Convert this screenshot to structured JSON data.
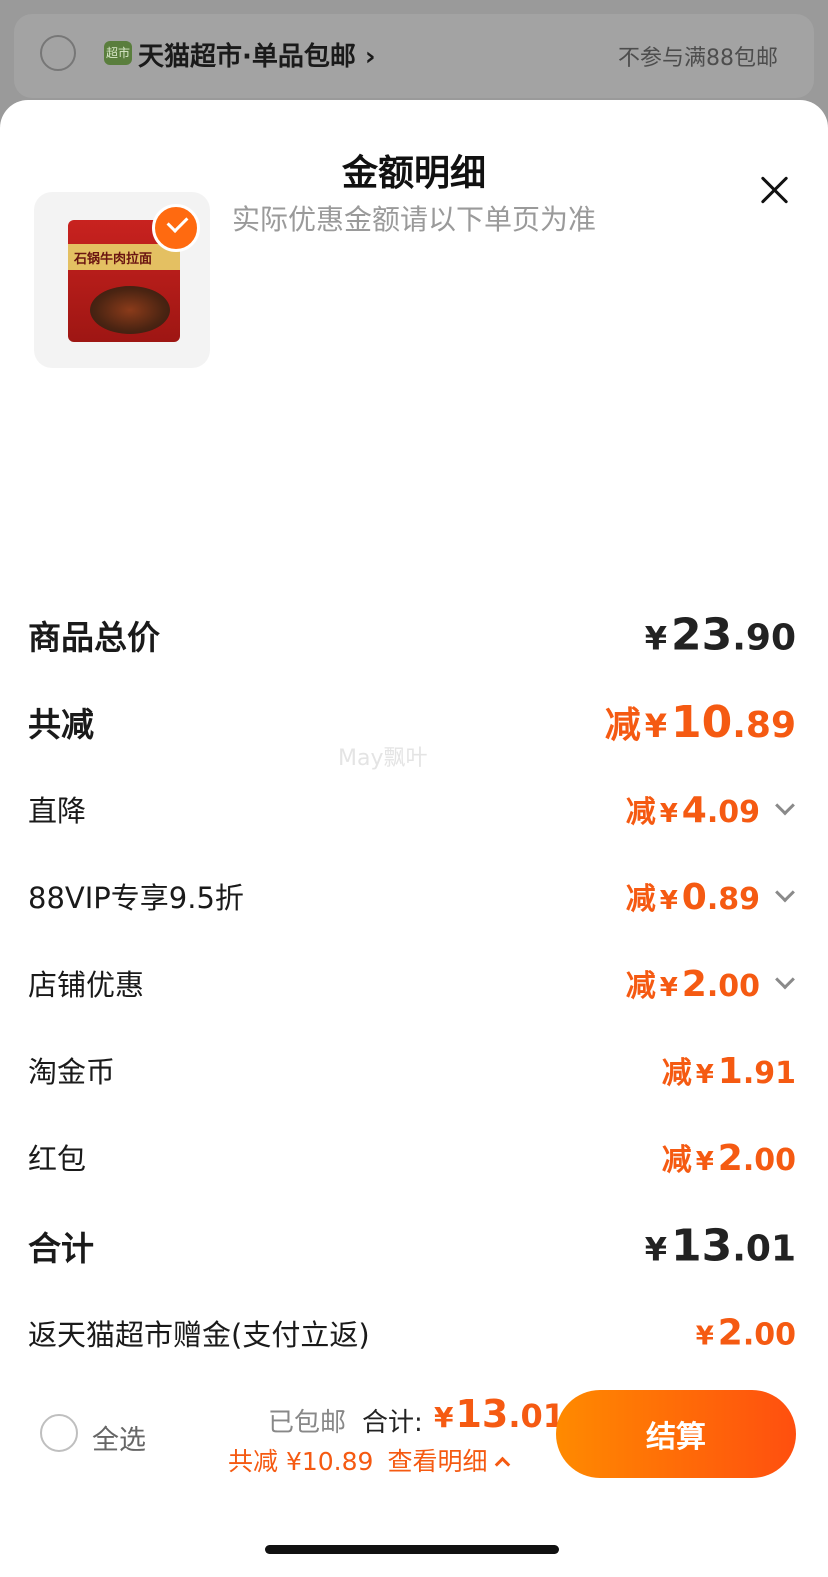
{
  "background": {
    "store_badge": "超市",
    "store_name": "天猫超市·单品包邮 ›",
    "store_note": "不参与满88包邮"
  },
  "sheet": {
    "title": "金额明细",
    "subtitle": "实际优惠金额请以下单页为准",
    "close_icon": "close-icon"
  },
  "product": {
    "pack_title": "石锅牛肉拉面",
    "selected": true
  },
  "rows": {
    "subtotal": {
      "label": "商品总价",
      "currency": "¥",
      "int": "23",
      "dec": ".90"
    },
    "total_reduce": {
      "label": "共减",
      "prefix": "减",
      "currency": "¥",
      "int": "10",
      "dec": ".89"
    },
    "direct": {
      "label": "直降",
      "prefix": "减",
      "currency": "¥",
      "int": "4",
      "dec": ".09"
    },
    "vip": {
      "label": "88VIP专享9.5折",
      "prefix": "减",
      "currency": "¥",
      "int": "0",
      "dec": ".89"
    },
    "store": {
      "label": "店铺优惠",
      "prefix": "减",
      "currency": "¥",
      "int": "2",
      "dec": ".00"
    },
    "coins": {
      "label": "淘金币",
      "prefix": "减",
      "currency": "¥",
      "int": "1",
      "dec": ".91"
    },
    "redpack": {
      "label": "红包",
      "prefix": "减",
      "currency": "¥",
      "int": "2",
      "dec": ".00"
    },
    "total": {
      "label": "合计",
      "currency": "¥",
      "int": "13",
      "dec": ".01"
    },
    "rebate": {
      "label": "返天猫超市赠金(支付立返)",
      "currency": "¥",
      "int": "2",
      "dec": ".00"
    }
  },
  "watermark": "May飘叶",
  "bottom": {
    "select_all": "全选",
    "shipping": "已包邮",
    "total_label": "合计:",
    "total_currency": "¥",
    "total_int": "13",
    "total_dec": ".01",
    "save_text": "共减 ¥10.89",
    "detail_link": "查看明细",
    "checkout": "结算"
  },
  "colors": {
    "accent": "#f55a12",
    "button_start": "#ff8a00",
    "button_end": "#ff4f0f"
  }
}
